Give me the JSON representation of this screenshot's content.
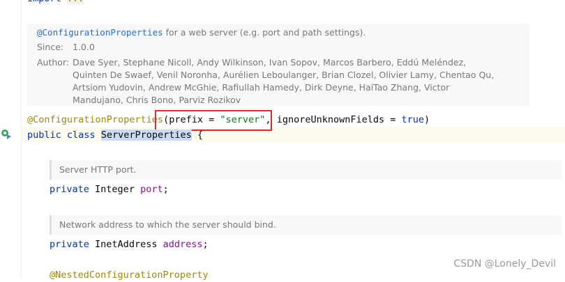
{
  "editor": {
    "top_line": {
      "keyword": "import",
      "folded": "..."
    },
    "javadoc": {
      "annotation_link": "@ConfigurationProperties",
      "summary": " for a web server (e.g. port and path settings).",
      "since_label": "Since:",
      "since_value": "1.0.0",
      "author_label": "Author:",
      "author_lines": [
        "Dave Syer, Stephane Nicoll, Andy Wilkinson, Ivan Sopov, Marcos Barbero, Eddú Meléndez,",
        "Quinten De Swaef, Venil Noronha, Aurélien Leboulanger, Brian Clozel, Olivier Lamy, Chentao Qu,",
        "Artsiom Yudovin, Andrew McGhie, Rafiullah Hamedy, Dirk Deyne, HaiTao Zhang, Victor",
        "Mandujano, Chris Bono, Parviz Rozikov"
      ]
    },
    "annotation_line": {
      "annotation": "@ConfigurationProperties",
      "open_paren": "(",
      "param1_name": "prefix",
      "eq1": " = ",
      "param1_value": "\"server\"",
      "comma": ", ",
      "param2_name": "ignoreUnknownFields",
      "eq2": " = ",
      "param2_value": "true",
      "close_paren": ")"
    },
    "class_line": {
      "modifier": "public",
      "keyword": "class",
      "class_name": "ServerProperties",
      "brace": "{"
    },
    "fields": [
      {
        "doc": "Server HTTP port.",
        "modifier": "private",
        "type": "Integer",
        "name": "port",
        "semicolon": ";"
      },
      {
        "doc": "Network address to which the server should bind.",
        "modifier": "private",
        "type": "InetAddress",
        "name": "address",
        "semicolon": ";"
      }
    ],
    "bottom_annotation": "@NestedConfigurationProperty"
  },
  "watermark": "CSDN @Lonely_Devil",
  "colors": {
    "keyword": "#0033b3",
    "annotation": "#9e880d",
    "string": "#067d17",
    "field": "#871094",
    "highlight_box": "#e02a2a"
  },
  "icons": {
    "gutter": "run-class-icon"
  }
}
